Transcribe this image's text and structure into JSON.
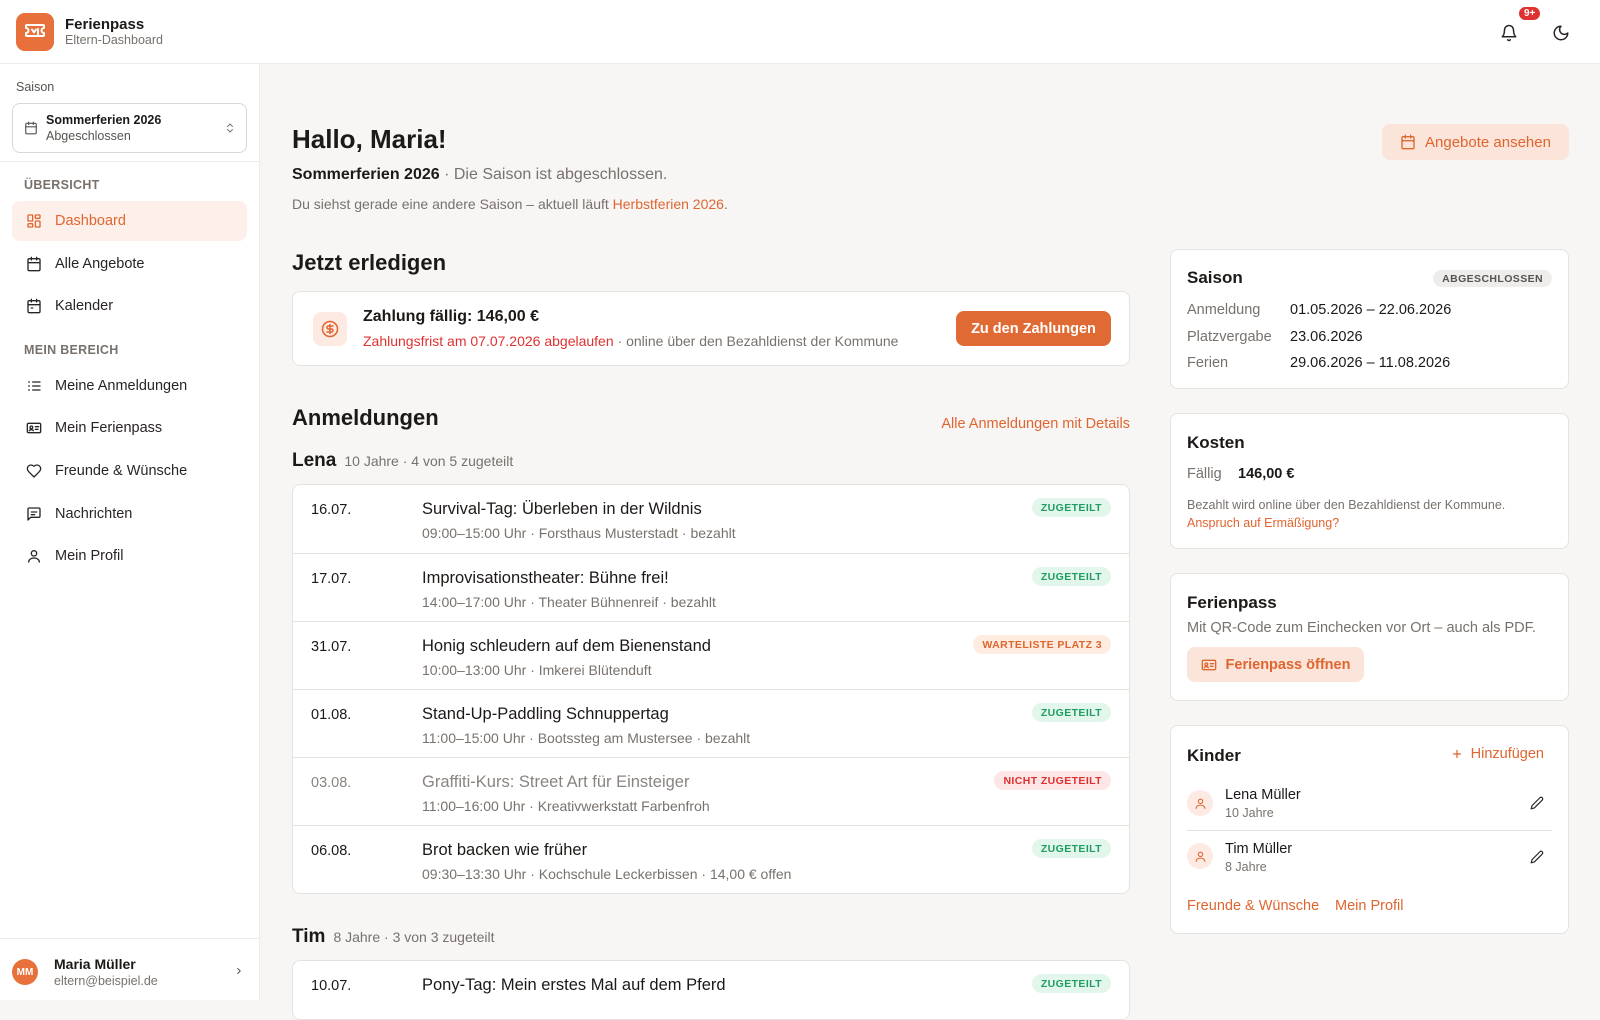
{
  "app": {
    "title": "Ferienpass",
    "subtitle": "Eltern-Dashboard",
    "notification_count": "9+"
  },
  "sidebar": {
    "season_label": "Saison",
    "season_select": {
      "name": "Sommerferien 2026",
      "status": "Abgeschlossen"
    },
    "section_overview": "ÜBERSICHT",
    "section_mine": "MEIN BEREICH",
    "items": [
      {
        "label": "Dashboard",
        "icon": "dashboard-icon"
      },
      {
        "label": "Alle Angebote",
        "icon": "calendar-icon"
      },
      {
        "label": "Kalender",
        "icon": "calendar-icon"
      },
      {
        "label": "Meine Anmeldungen",
        "icon": "list-icon"
      },
      {
        "label": "Mein Ferienpass",
        "icon": "id-card-icon"
      },
      {
        "label": "Freunde & Wünsche",
        "icon": "heart-icon"
      },
      {
        "label": "Nachrichten",
        "icon": "message-icon"
      },
      {
        "label": "Mein Profil",
        "icon": "user-icon"
      }
    ],
    "user": {
      "initials": "MM",
      "name": "Maria Müller",
      "email": "eltern@beispiel.de"
    }
  },
  "main": {
    "greeting": "Hallo, Maria!",
    "season_name": "Sommerferien 2026",
    "season_status_text": " · Die Saison ist abgeschlossen.",
    "info_prefix": "Du siehst gerade eine andere Saison – aktuell läuft ",
    "info_link": "Herbstferien 2026",
    "info_suffix": ".",
    "offers_button": "Angebote ansehen",
    "todo_heading": "Jetzt erledigen",
    "todo": {
      "title": "Zahlung fällig: 146,00 €",
      "deadline": "Zahlungsfrist am 07.07.2026 abgelaufen",
      "note": " · online über den Bezahldienst der Kommune",
      "button": "Zu den Zahlungen"
    },
    "registrations_heading": "Anmeldungen",
    "registrations_link": "Alle Anmeldungen mit Details",
    "children": [
      {
        "name": "Lena",
        "meta": "10 Jahre · 4 von 5 zugeteilt",
        "rows": [
          {
            "date": "16.07.",
            "title": "Survival-Tag: Überleben in der Wildnis",
            "sub": "09:00–15:00 Uhr · Forsthaus Musterstadt · bezahlt",
            "status": "ZUGETEILT"
          },
          {
            "date": "17.07.",
            "title": "Improvisationstheater: Bühne frei!",
            "sub": "14:00–17:00 Uhr · Theater Bühnenreif · bezahlt",
            "status": "ZUGETEILT"
          },
          {
            "date": "31.07.",
            "title": "Honig schleudern auf dem Bienenstand",
            "sub": "10:00–13:00 Uhr · Imkerei Blütenduft",
            "status": "WARTELISTE PLATZ 3"
          },
          {
            "date": "01.08.",
            "title": "Stand-Up-Paddling Schnuppertag",
            "sub": "11:00–15:00 Uhr · Bootssteg am Mustersee · bezahlt",
            "status": "ZUGETEILT"
          },
          {
            "date": "03.08.",
            "title": "Graffiti-Kurs: Street Art für Einsteiger",
            "sub": "11:00–16:00 Uhr · Kreativwerkstatt Farbenfroh",
            "status": "NICHT ZUGETEILT"
          },
          {
            "date": "06.08.",
            "title": "Brot backen wie früher",
            "sub": "09:30–13:30 Uhr · Kochschule Leckerbissen · 14,00 € offen",
            "status": "ZUGETEILT"
          }
        ]
      },
      {
        "name": "Tim",
        "meta": "8 Jahre · 3 von 3 zugeteilt",
        "rows": [
          {
            "date": "10.07.",
            "title": "Pony-Tag: Mein erstes Mal auf dem Pferd",
            "sub": "",
            "status": "ZUGETEILT"
          }
        ]
      }
    ]
  },
  "right": {
    "season": {
      "title": "Saison",
      "badge": "ABGESCHLOSSEN",
      "rows": [
        {
          "label": "Anmeldung",
          "value": "01.05.2026 – 22.06.2026"
        },
        {
          "label": "Platzvergabe",
          "value": "23.06.2026"
        },
        {
          "label": "Ferien",
          "value": "29.06.2026 – 11.08.2026"
        }
      ]
    },
    "costs": {
      "title": "Kosten",
      "due_label": "Fällig",
      "due_value": "146,00 €",
      "note": "Bezahlt wird online über den Bezahldienst der Kommune.",
      "link": "Anspruch auf Ermäßigung?"
    },
    "pass": {
      "title": "Ferienpass",
      "text": "Mit QR-Code zum Einchecken vor Ort – auch als PDF.",
      "button": "Ferienpass öffnen"
    },
    "kids": {
      "title": "Kinder",
      "add": "Hinzufügen",
      "list": [
        {
          "name": "Lena Müller",
          "age": "10 Jahre"
        },
        {
          "name": "Tim Müller",
          "age": "8 Jahre"
        }
      ],
      "link_friends": "Freunde & Wünsche",
      "link_profile": "Mein Profil"
    }
  },
  "colors": {
    "accent": "#e0652f",
    "green": "#1f9d63",
    "red": "#e03131"
  }
}
